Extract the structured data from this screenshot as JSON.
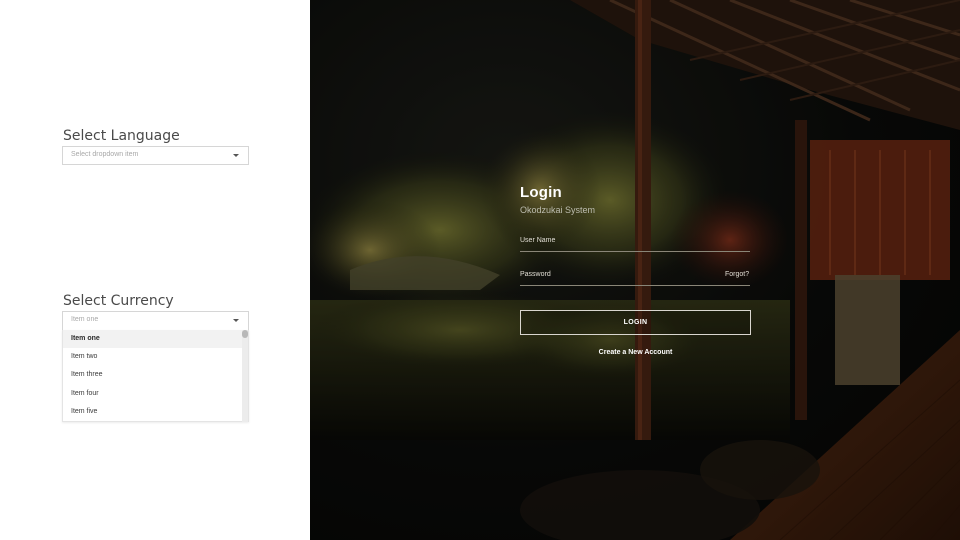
{
  "settings": {
    "language": {
      "title": "Select Language",
      "placeholder": "Select dropdown item"
    },
    "currency": {
      "title": "Select Currency",
      "selected": "Item one",
      "options": [
        "Item one",
        "Item two",
        "Item three",
        "Item four",
        "Item five"
      ]
    }
  },
  "login": {
    "title": "Login",
    "subtitle": "Okodzukai System",
    "username_label": "User Name",
    "password_label": "Password",
    "forgot_label": "Forgot?",
    "login_button": "LOGIN",
    "create_account": "Create a New Account"
  },
  "colors": {
    "button_border": "#d9d6cf",
    "text_light": "#ffffff",
    "panel_bg": "#ffffff"
  }
}
